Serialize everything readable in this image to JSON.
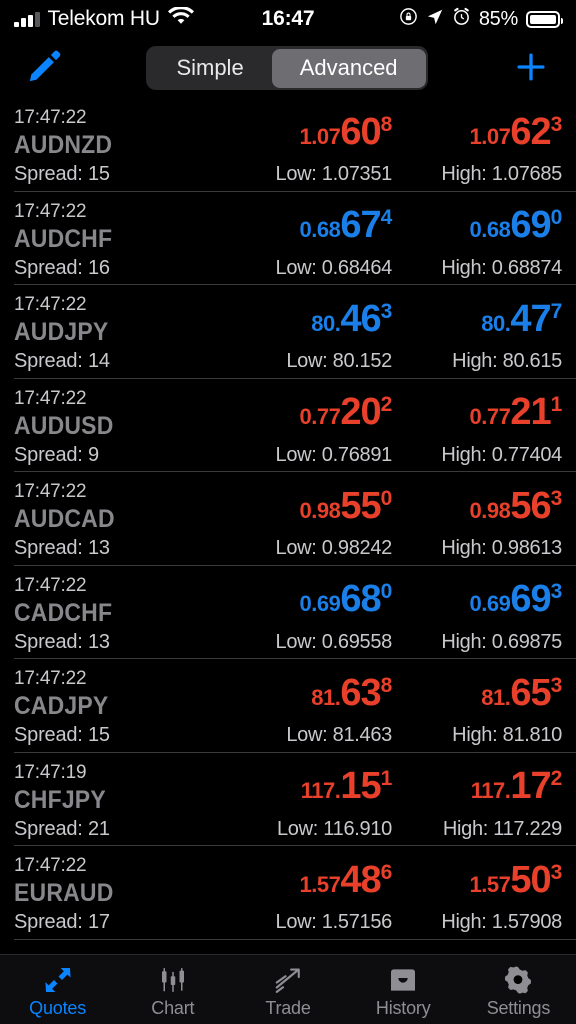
{
  "status_bar": {
    "carrier": "Telekom HU",
    "time": "16:47",
    "battery_percent": "85%",
    "icons": [
      "signal-bars-icon",
      "wifi-icon",
      "rotation-lock-icon",
      "location-arrow-icon",
      "alarm-clock-icon",
      "battery-icon"
    ]
  },
  "toolbar": {
    "edit_icon": "pencil-icon",
    "add_icon": "plus-icon",
    "segments": [
      {
        "label": "Simple",
        "active": false
      },
      {
        "label": "Advanced",
        "active": true
      }
    ]
  },
  "colors": {
    "up": "#1a7fe8",
    "down": "#e8402a",
    "accent": "#0a84ff",
    "background": "#000000",
    "separator": "#3a3a3c",
    "symbol": "#88888c",
    "secondary_text": "#c9c9cd"
  },
  "quotes": [
    {
      "time": "17:47:22",
      "symbol": "AUDNZD",
      "spread": "Spread: 15",
      "bid": {
        "prefix": "1.07",
        "main": "60",
        "sup": "8",
        "dir": "down"
      },
      "ask": {
        "prefix": "1.07",
        "main": "62",
        "sup": "3",
        "dir": "down"
      },
      "low": "Low: 1.07351",
      "high": "High: 1.07685"
    },
    {
      "time": "17:47:22",
      "symbol": "AUDCHF",
      "spread": "Spread: 16",
      "bid": {
        "prefix": "0.68",
        "main": "67",
        "sup": "4",
        "dir": "up"
      },
      "ask": {
        "prefix": "0.68",
        "main": "69",
        "sup": "0",
        "dir": "up"
      },
      "low": "Low: 0.68464",
      "high": "High: 0.68874"
    },
    {
      "time": "17:47:22",
      "symbol": "AUDJPY",
      "spread": "Spread: 14",
      "bid": {
        "prefix": "80.",
        "main": "46",
        "sup": "3",
        "dir": "up"
      },
      "ask": {
        "prefix": "80.",
        "main": "47",
        "sup": "7",
        "dir": "up"
      },
      "low": "Low: 80.152",
      "high": "High: 80.615"
    },
    {
      "time": "17:47:22",
      "symbol": "AUDUSD",
      "spread": "Spread: 9",
      "bid": {
        "prefix": "0.77",
        "main": "20",
        "sup": "2",
        "dir": "down"
      },
      "ask": {
        "prefix": "0.77",
        "main": "21",
        "sup": "1",
        "dir": "down"
      },
      "low": "Low: 0.76891",
      "high": "High: 0.77404"
    },
    {
      "time": "17:47:22",
      "symbol": "AUDCAD",
      "spread": "Spread: 13",
      "bid": {
        "prefix": "0.98",
        "main": "55",
        "sup": "0",
        "dir": "down"
      },
      "ask": {
        "prefix": "0.98",
        "main": "56",
        "sup": "3",
        "dir": "down"
      },
      "low": "Low: 0.98242",
      "high": "High: 0.98613"
    },
    {
      "time": "17:47:22",
      "symbol": "CADCHF",
      "spread": "Spread: 13",
      "bid": {
        "prefix": "0.69",
        "main": "68",
        "sup": "0",
        "dir": "up"
      },
      "ask": {
        "prefix": "0.69",
        "main": "69",
        "sup": "3",
        "dir": "up"
      },
      "low": "Low: 0.69558",
      "high": "High: 0.69875"
    },
    {
      "time": "17:47:22",
      "symbol": "CADJPY",
      "spread": "Spread: 15",
      "bid": {
        "prefix": "81.",
        "main": "63",
        "sup": "8",
        "dir": "down"
      },
      "ask": {
        "prefix": "81.",
        "main": "65",
        "sup": "3",
        "dir": "down"
      },
      "low": "Low: 81.463",
      "high": "High: 81.810"
    },
    {
      "time": "17:47:19",
      "symbol": "CHFJPY",
      "spread": "Spread: 21",
      "bid": {
        "prefix": "117.",
        "main": "15",
        "sup": "1",
        "dir": "down"
      },
      "ask": {
        "prefix": "117.",
        "main": "17",
        "sup": "2",
        "dir": "down"
      },
      "low": "Low: 116.910",
      "high": "High: 117.229"
    },
    {
      "time": "17:47:22",
      "symbol": "EURAUD",
      "spread": "Spread: 17",
      "bid": {
        "prefix": "1.57",
        "main": "48",
        "sup": "6",
        "dir": "down"
      },
      "ask": {
        "prefix": "1.57",
        "main": "50",
        "sup": "3",
        "dir": "down"
      },
      "low": "Low: 1.57156",
      "high": "High: 1.57908"
    }
  ],
  "tabbar": {
    "items": [
      {
        "label": "Quotes",
        "icon": "quotes-arrows-icon",
        "active": true
      },
      {
        "label": "Chart",
        "icon": "candlestick-icon",
        "active": false
      },
      {
        "label": "Trade",
        "icon": "trend-arrow-icon",
        "active": false
      },
      {
        "label": "History",
        "icon": "inbox-tray-icon",
        "active": false
      },
      {
        "label": "Settings",
        "icon": "gear-icon",
        "active": false
      }
    ]
  }
}
